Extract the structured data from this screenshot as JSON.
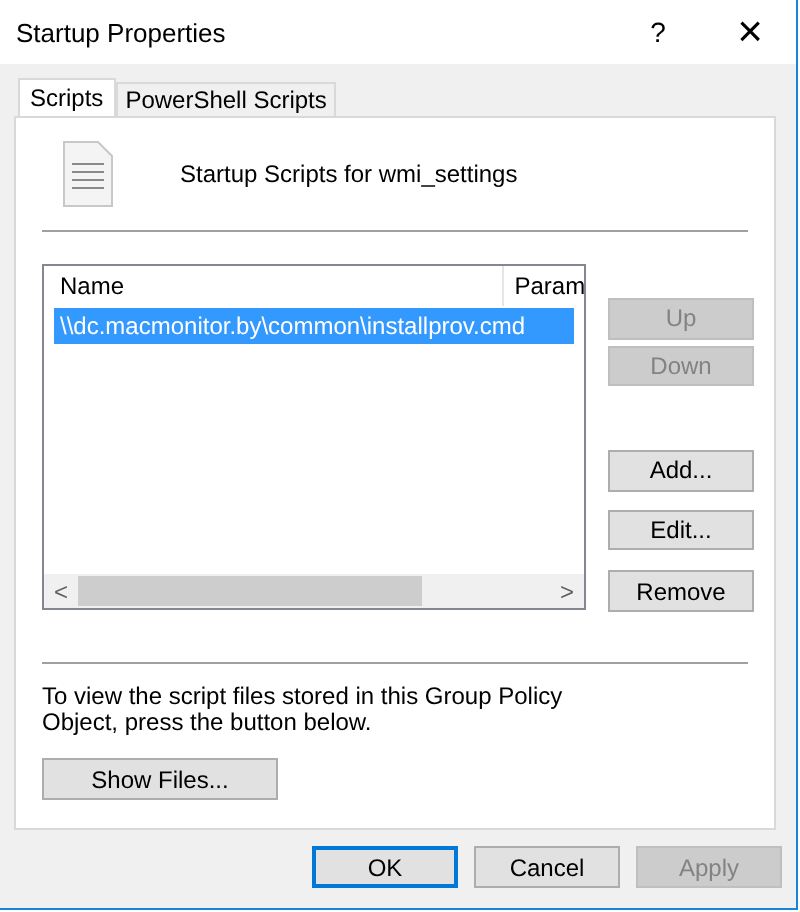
{
  "window": {
    "title": "Startup Properties",
    "help": "?",
    "close": "×"
  },
  "tabs": [
    {
      "label": "Scripts",
      "selected": true
    },
    {
      "label": "PowerShell Scripts",
      "selected": false
    }
  ],
  "heading": "Startup Scripts for wmi_settings",
  "table": {
    "columns": [
      "Name",
      "Param"
    ],
    "rows": [
      {
        "name": "\\\\dc.macmonitor.by\\common\\installprov.cmd",
        "selected": true
      }
    ],
    "scroll_left": "<",
    "scroll_right": ">"
  },
  "side_buttons": [
    {
      "label": "Up",
      "disabled": true
    },
    {
      "label": "Down",
      "disabled": true
    },
    {
      "label": "Add...",
      "disabled": false
    },
    {
      "label": "Edit...",
      "disabled": false
    },
    {
      "label": "Remove",
      "disabled": false
    }
  ],
  "info": "To view the script files stored in this Group Policy Object, press the button below.",
  "show_files": "Show Files...",
  "footer_buttons": [
    {
      "label": "OK",
      "disabled": false,
      "default": true
    },
    {
      "label": "Cancel",
      "disabled": false,
      "default": false
    },
    {
      "label": "Apply",
      "disabled": true,
      "default": false
    }
  ]
}
